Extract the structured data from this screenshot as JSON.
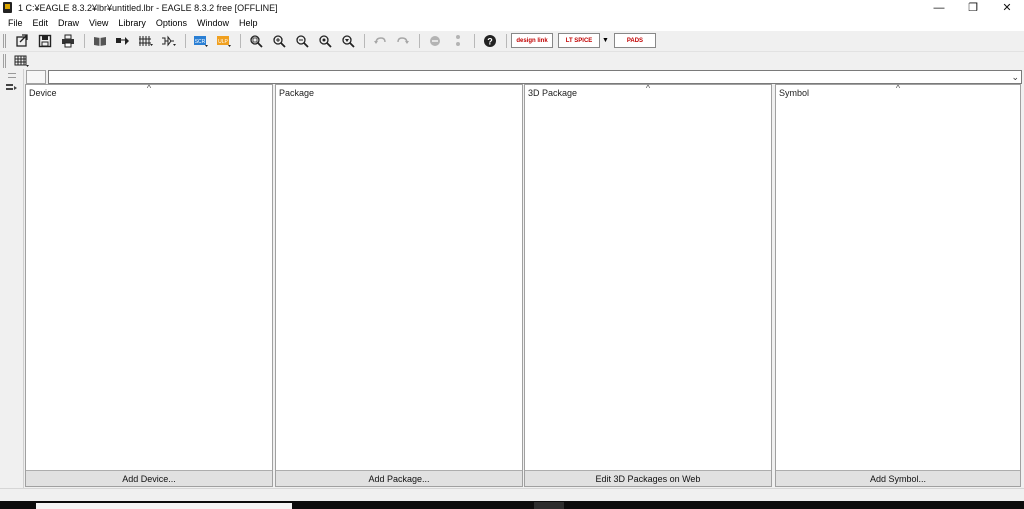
{
  "window": {
    "title": "1 C:¥EAGLE 8.3.2¥lbr¥untitled.lbr - EAGLE 8.3.2 free [OFFLINE]",
    "controls": {
      "minimize": "—",
      "restore": "❐",
      "close": "✕"
    }
  },
  "menubar": {
    "items": [
      "File",
      "Edit",
      "Draw",
      "View",
      "Library",
      "Options",
      "Window",
      "Help"
    ]
  },
  "toolbar": {
    "buttons": [
      "open-icon",
      "save-icon",
      "print-icon",
      "book-icon",
      "package-icon",
      "pins-icon",
      "symbol-icon",
      "script-icon",
      "ulp-icon",
      "zoom-fit-icon",
      "zoom-in-icon",
      "zoom-out-icon",
      "zoom-select-icon",
      "zoom-redraw-icon",
      "undo-icon",
      "redo-icon",
      "stop-icon",
      "go-icon",
      "help-icon"
    ],
    "logos": {
      "designlink": "design link",
      "ltspice": "LT SPICE",
      "pads": "PADS"
    }
  },
  "command_line": {
    "value": ""
  },
  "panels": [
    {
      "title": "Device",
      "button": "Add Device..."
    },
    {
      "title": "Package",
      "button": "Add Package..."
    },
    {
      "title": "3D Package",
      "button": "Edit 3D Packages on Web"
    },
    {
      "title": "Symbol",
      "button": "Add Symbol..."
    }
  ],
  "colors": {
    "toolbar_bg": "#f0f0f0",
    "panel_bg": "#ffffff",
    "button_bg": "#e1e1e1",
    "logo_red": "#c00000"
  }
}
